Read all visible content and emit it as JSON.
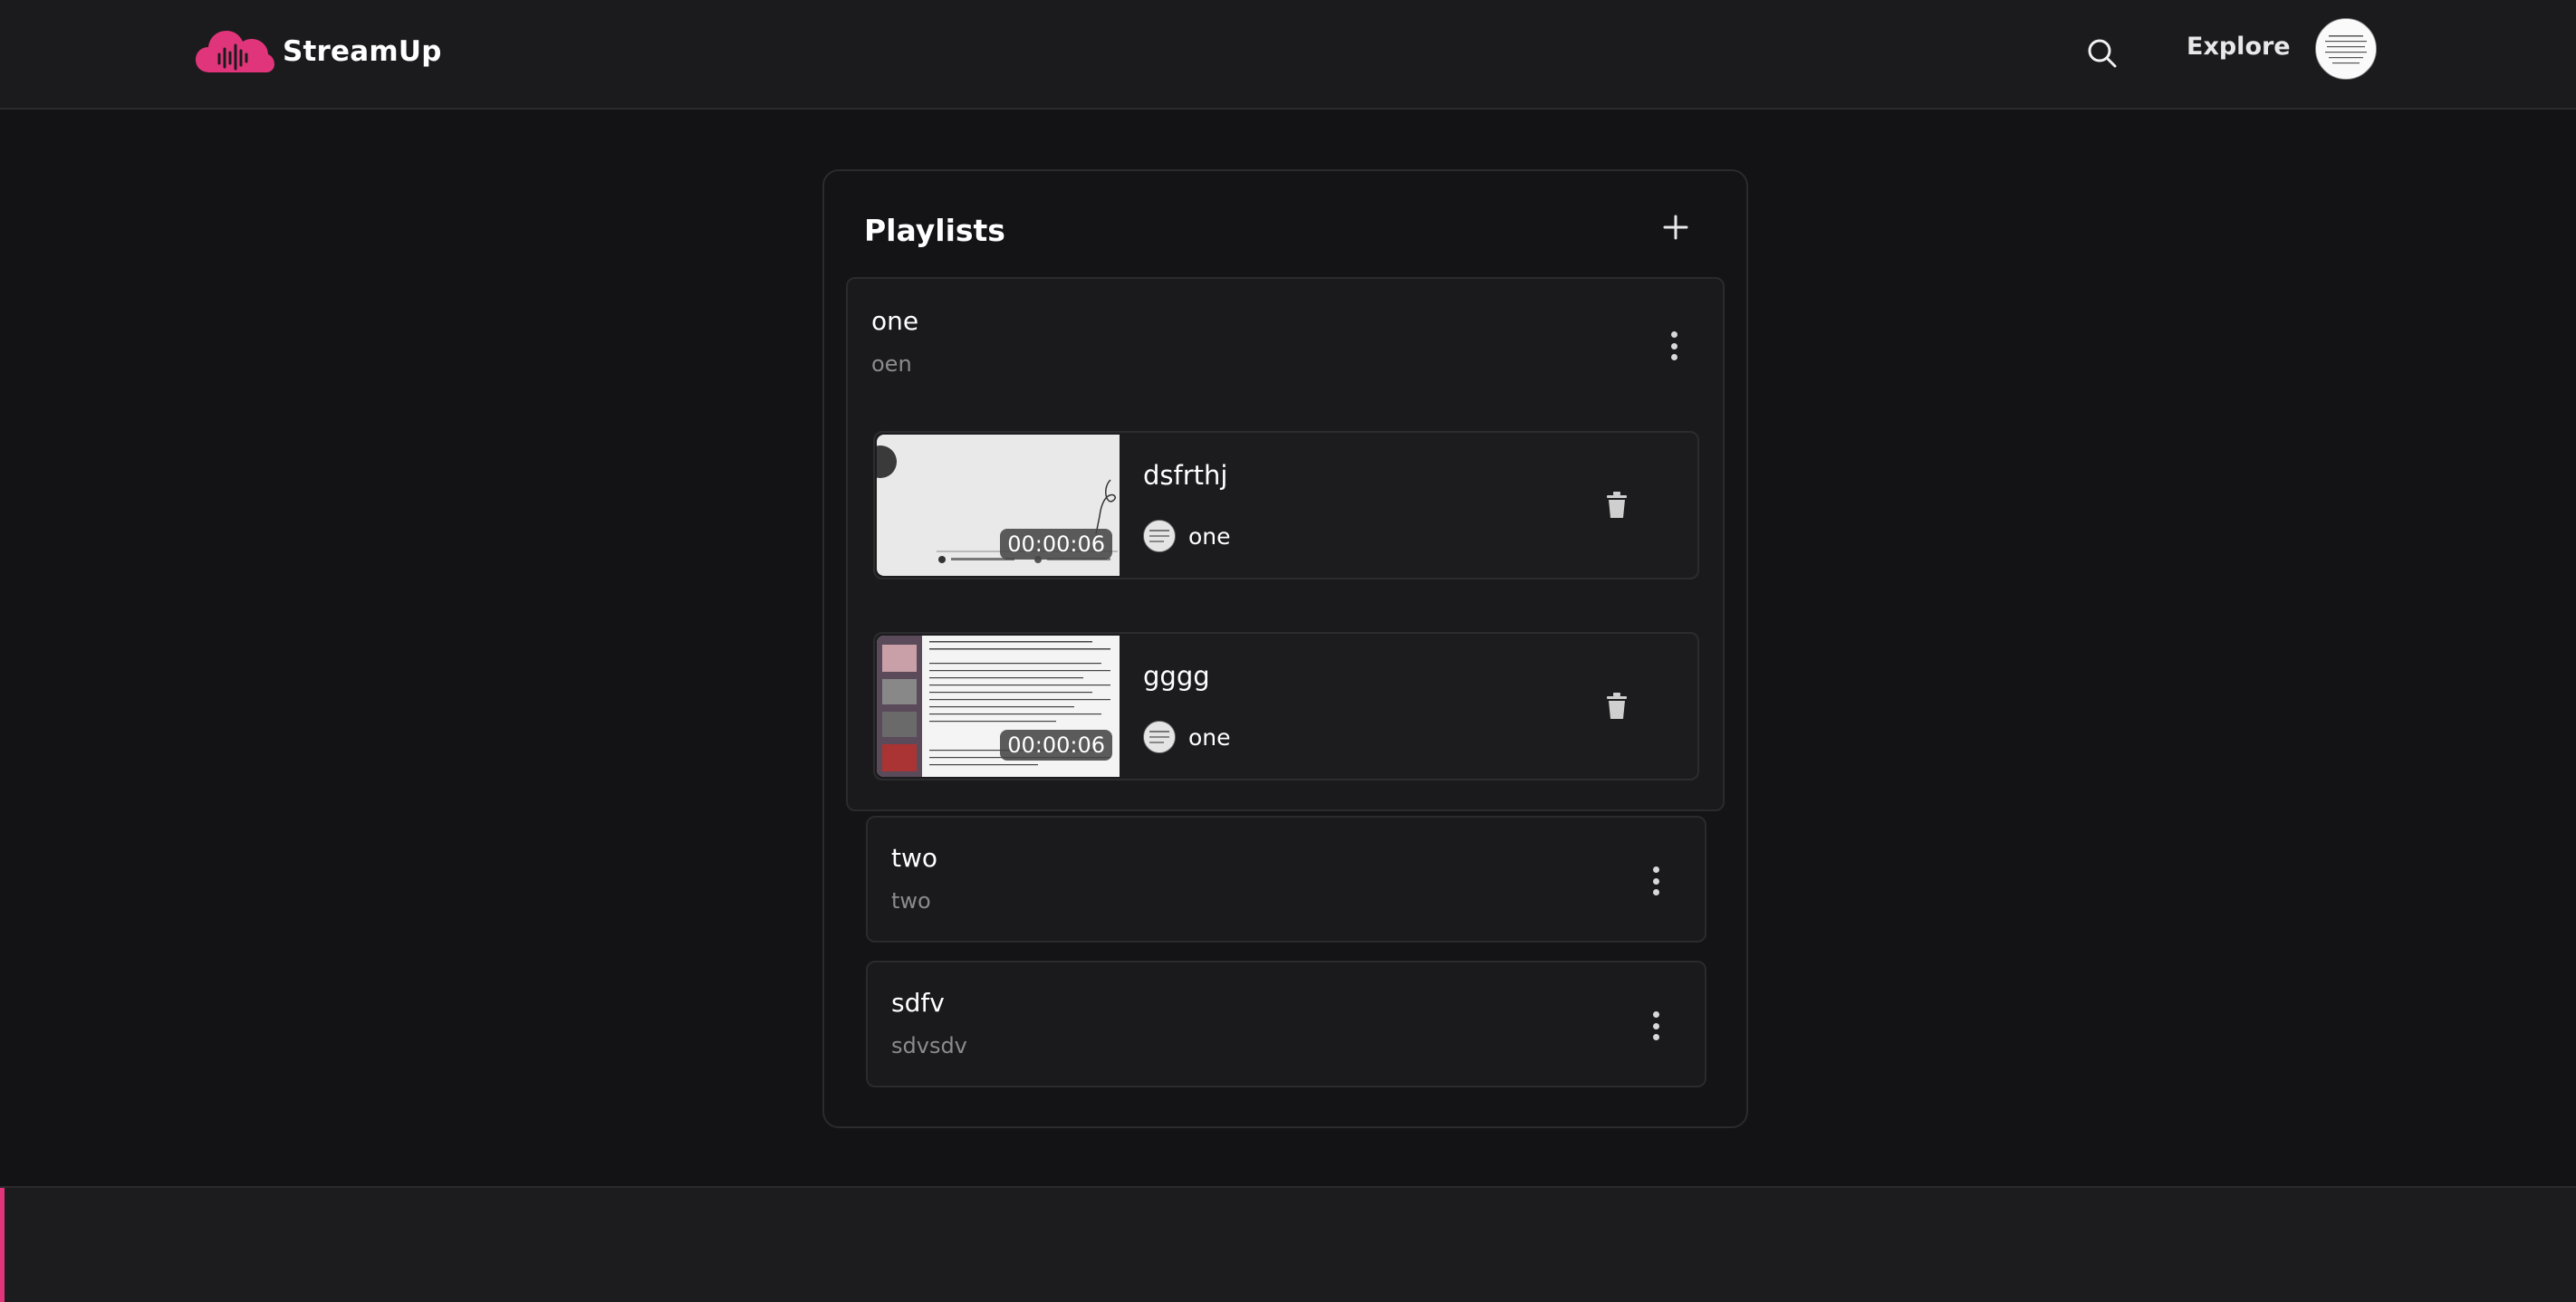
{
  "header": {
    "brand_name": "StreamUp",
    "explore_label": "Explore",
    "accent_color": "#e0357a"
  },
  "playlists": {
    "title": "Playlists",
    "expanded": {
      "name": "one",
      "description": "oen",
      "videos": [
        {
          "title": "dsfrthj",
          "duration": "00:00:06",
          "channel": "one"
        },
        {
          "title": "gggg",
          "duration": "00:00:06",
          "channel": "one"
        }
      ]
    },
    "collapsed": [
      {
        "name": "two",
        "description": "two"
      },
      {
        "name": "sdfv",
        "description": "sdvsdv"
      }
    ]
  },
  "icons": [
    "cloud-soundwave-logo",
    "search-icon",
    "plus-icon",
    "more-vertical-icon",
    "trash-icon"
  ]
}
